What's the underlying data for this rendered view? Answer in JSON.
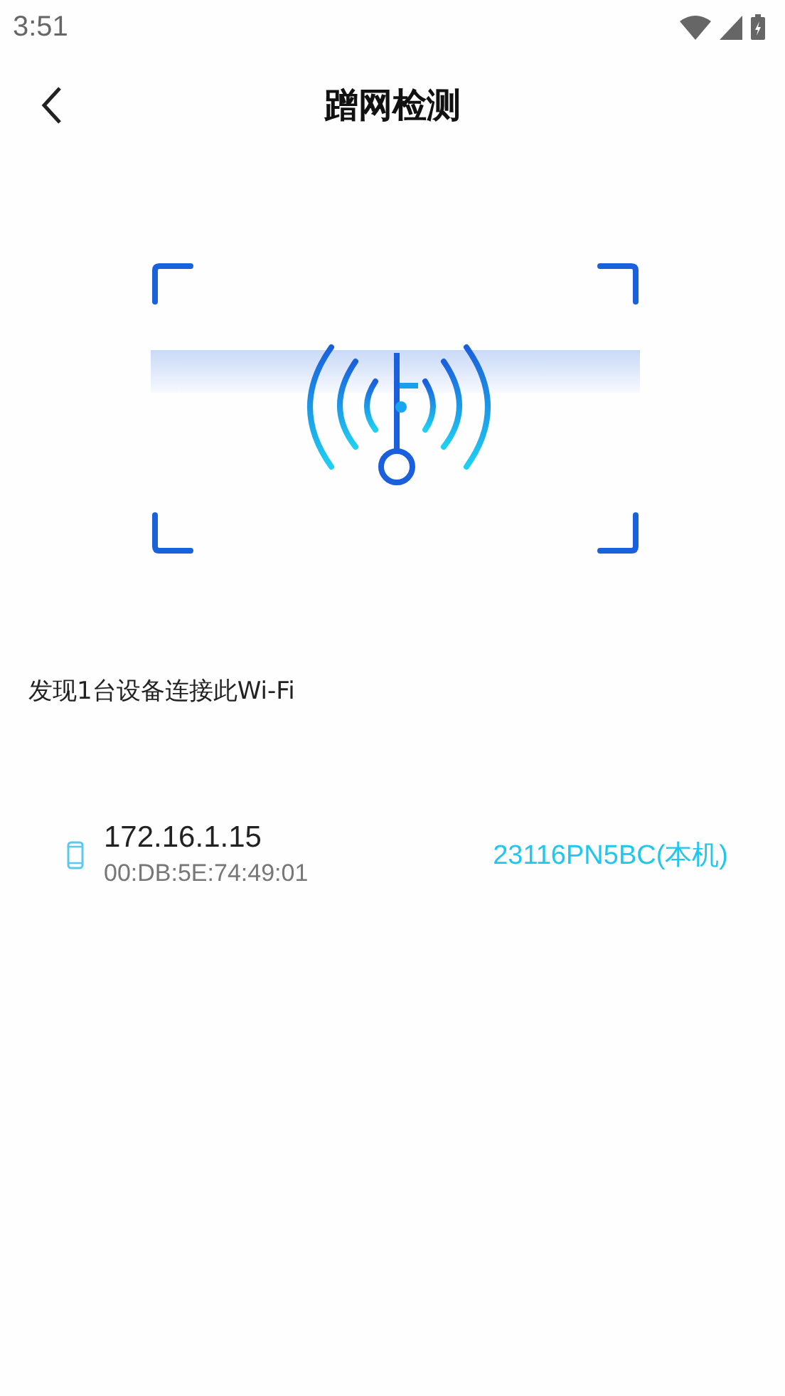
{
  "status_bar": {
    "time": "3:51"
  },
  "header": {
    "title": "蹭网检测"
  },
  "summary": "发现1台设备连接此Wi-Fi",
  "devices": [
    {
      "ip": "172.16.1.15",
      "mac": "00:DB:5E:74:49:01",
      "name": "23116PN5BC(本机)"
    }
  ]
}
